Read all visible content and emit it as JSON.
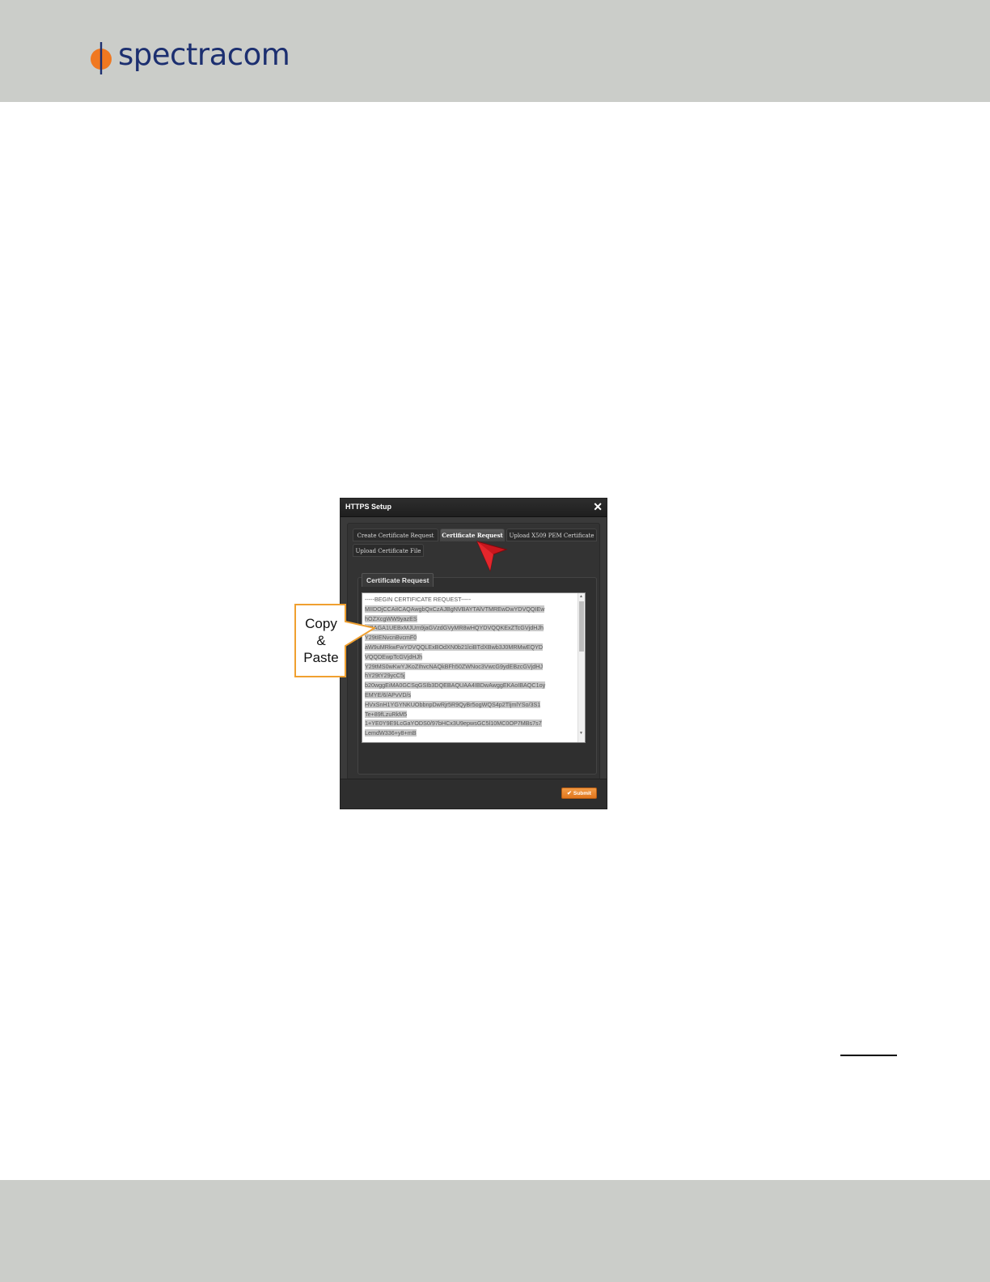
{
  "brand": {
    "name": "spectracom",
    "accent": "#f07820",
    "text_color": "#1c2f70"
  },
  "dialog": {
    "title": "HTTPS Setup",
    "close_glyph": "✕",
    "tabs": [
      {
        "label": "Create Certificate Request",
        "active": false
      },
      {
        "label": "Certificate Request",
        "active": true
      },
      {
        "label": "Upload X509 PEM Certificate",
        "active": false
      },
      {
        "label": "Upload Certificate File",
        "active": false
      }
    ],
    "panel_title": "Certificate Request",
    "certificate_lines": [
      "-----BEGIN CERTIFICATE REQUEST-----",
      "MIIDOjCCAiICAQAwgbQxCzAJBgNVBAYTAlVTMREwDwYDVQQIEw",
      "hOZXcgWW9yazES",
      "MBAGA1UEBxMJUm9jaGVzdGVyMR8wHQYDVQQKExZTcGVjdHJh",
      "Y29tIENvcnBvcmF0",
      "aW9uMRkwFwYDVQQLExBOdXN0b21lciBTdXBwb3J0MRMwEQYD",
      "VQQDEwpTcGVjdHJh",
      "Y29tMS0wKwYJKoZIhvcNAQkBFh50ZWNoc3VwcG9ydEBzcGVjdHJ",
      "hY29tY29ycC5j",
      "b20wggEiMA0GCSqGSIb3DQEBAQUAA4IBDwAwggEKAoIBAQC1oy",
      "EMYE/6/APvVD/s",
      "HVxSnH1YGYNKUObbnpDwRjr5R9QyBr5ogWQS4p2TljmlYSo/3S1",
      "Te+89fLzuRkM5",
      "1+YE0Y9E9LcGaYODS0/97bHCx3U9epwsGC5l10MC0OP7MBs7s7",
      "LemdW336+y8+mB"
    ],
    "submit_label": "Submit",
    "check_glyph": "✔"
  },
  "callout": {
    "lines": [
      "Copy",
      "&",
      "Paste"
    ]
  }
}
